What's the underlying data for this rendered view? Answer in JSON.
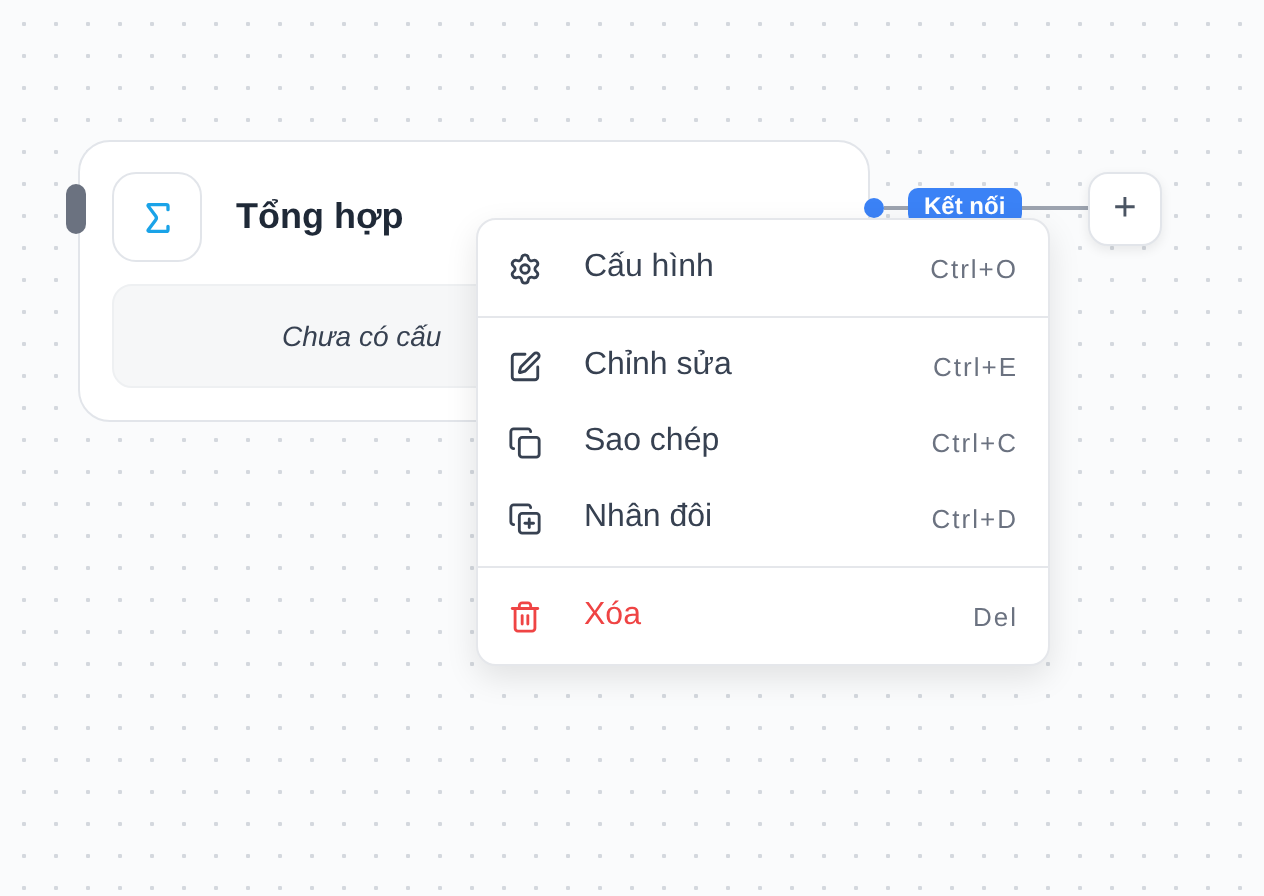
{
  "node": {
    "title": "Tổng hợp",
    "summary": "Chưa có cấu"
  },
  "edge": {
    "label": "Kết nối"
  },
  "add_button": {
    "label": "+"
  },
  "context_menu": {
    "groups": [
      [
        {
          "label": "Cấu hình",
          "shortcut": "Ctrl+O",
          "kind": "normal"
        }
      ],
      [
        {
          "label": "Chỉnh sửa",
          "shortcut": "Ctrl+E",
          "kind": "normal"
        },
        {
          "label": "Sao chép",
          "shortcut": "Ctrl+C",
          "kind": "normal"
        },
        {
          "label": "Nhân đôi",
          "shortcut": "Ctrl+D",
          "kind": "normal"
        }
      ],
      [
        {
          "label": "Xóa",
          "shortcut": "Del",
          "kind": "danger"
        }
      ]
    ]
  }
}
